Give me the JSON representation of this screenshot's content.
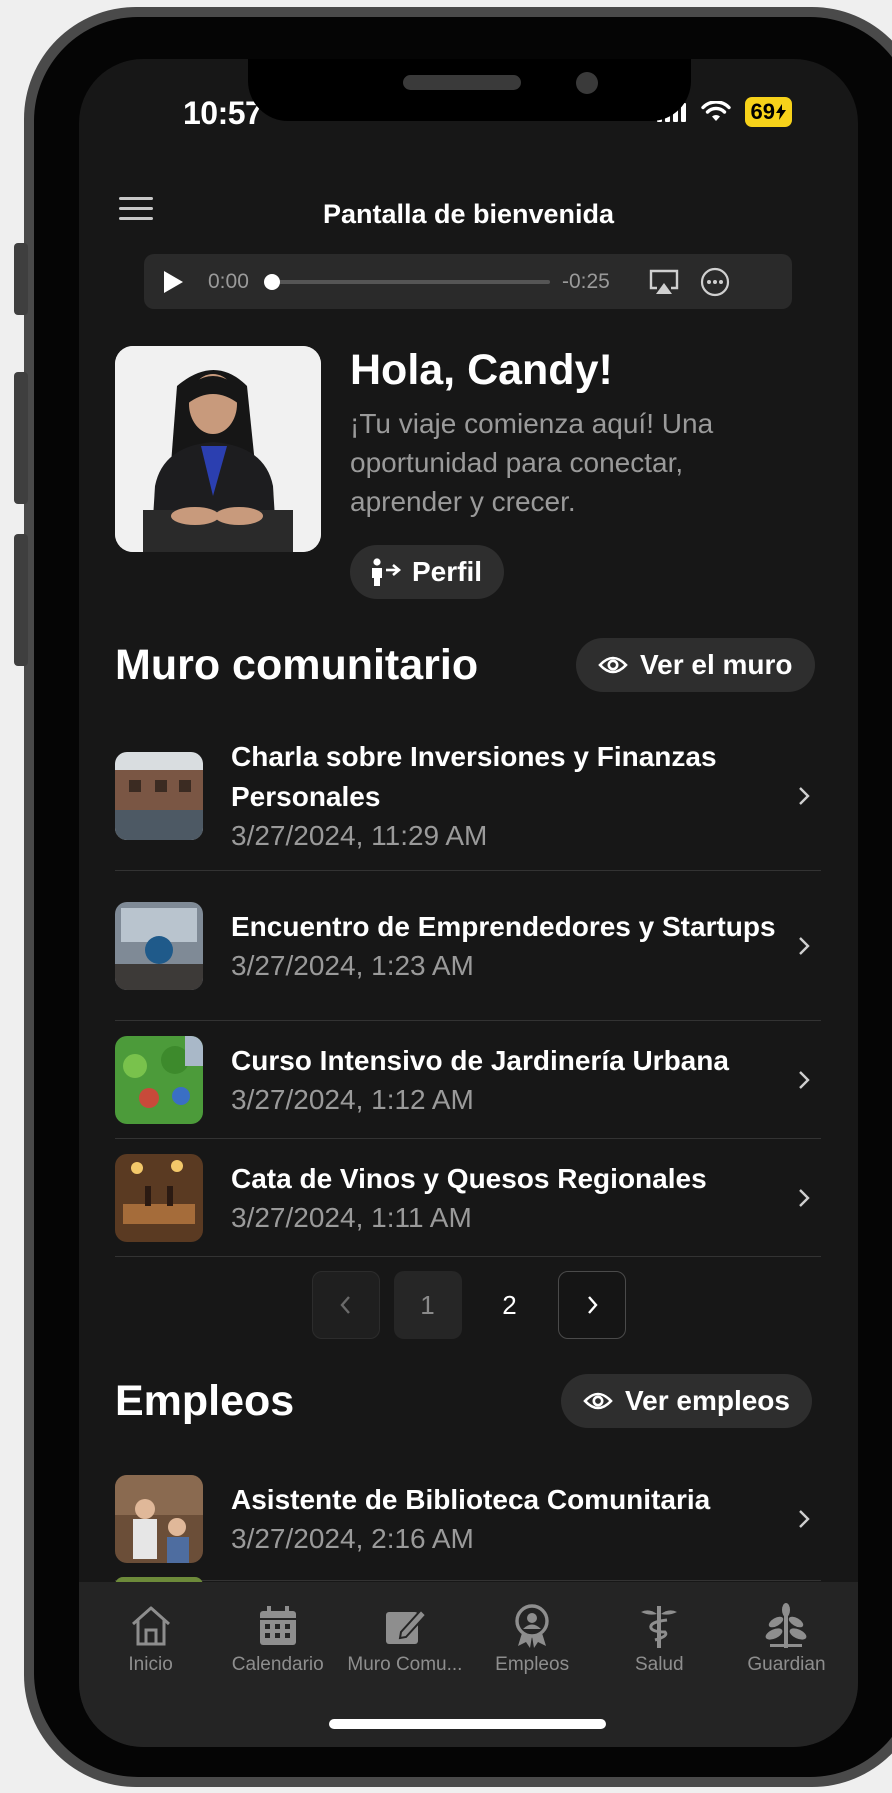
{
  "status_bar": {
    "time": "10:57",
    "battery": "69"
  },
  "header": {
    "title": "Pantalla de bienvenida"
  },
  "audio": {
    "elapsed": "0:00",
    "remaining": "-0:25",
    "progress": 0.0
  },
  "welcome": {
    "title": "Hola, Candy!",
    "text": "¡Tu viaje comienza aquí! Una oportunidad para conectar, aprender y crecer.",
    "profile_button": "Perfil"
  },
  "wall": {
    "title": "Muro comunitario",
    "view_button": "Ver el muro",
    "items": [
      {
        "title": "Charla sobre Inversiones y Finanzas Personales",
        "date": "3/27/2024, 11:29 AM"
      },
      {
        "title": "Encuentro de Emprendedores y Startups",
        "date": "3/27/2024, 1:23 AM"
      },
      {
        "title": "Curso Intensivo de Jardinería Urbana",
        "date": "3/27/2024, 1:12 AM"
      },
      {
        "title": "Cata de Vinos y Quesos Regionales",
        "date": "3/27/2024, 1:11 AM"
      }
    ]
  },
  "pagination": {
    "pages": [
      "1",
      "2"
    ],
    "current": "1"
  },
  "jobs": {
    "title": "Empleos",
    "view_button": "Ver empleos",
    "items": [
      {
        "title": "Asistente de Biblioteca Comunitaria",
        "date": "3/27/2024, 2:16 AM"
      }
    ]
  },
  "tabbar": {
    "items": [
      {
        "label": "Inicio",
        "icon": "home-icon"
      },
      {
        "label": "Calendario",
        "icon": "calendar-icon"
      },
      {
        "label": "Muro Comu...",
        "icon": "edit-icon"
      },
      {
        "label": "Empleos",
        "icon": "badge-icon"
      },
      {
        "label": "Salud",
        "icon": "caduceus-icon"
      },
      {
        "label": "Guardian",
        "icon": "plant-icon"
      }
    ]
  },
  "colors": {
    "background": "#171717",
    "surface": "#2e2e2e",
    "text": "#ffffff",
    "muted": "#9a9a9a",
    "battery": "#f7d21a"
  }
}
